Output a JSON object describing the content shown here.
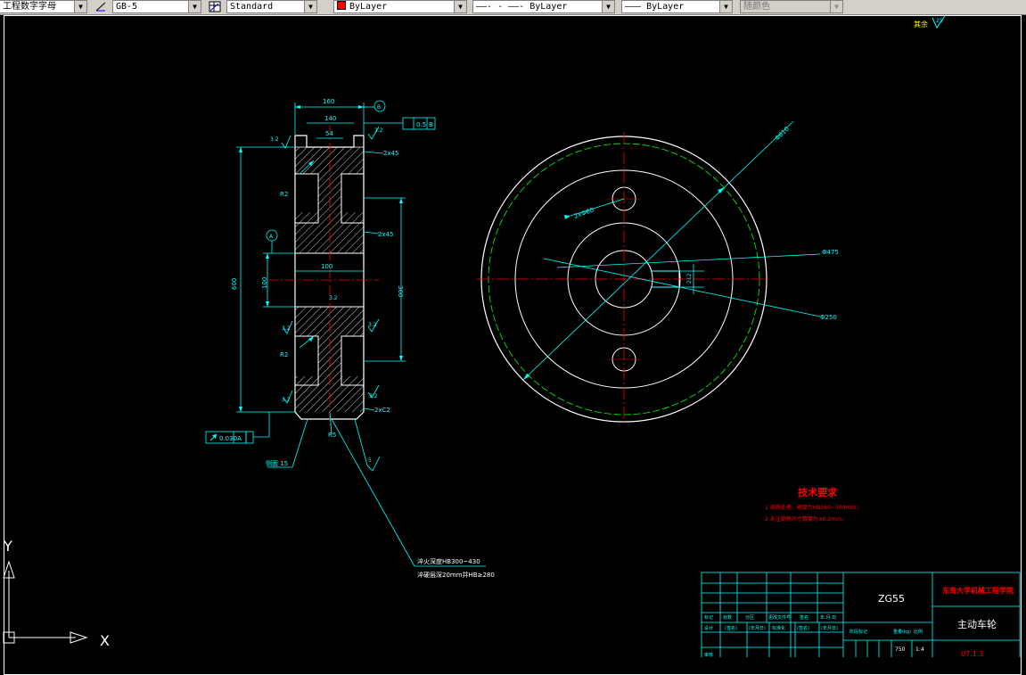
{
  "toolbar": {
    "text_style": "工程数字字母",
    "dim_style": "GB-5",
    "table_style": "Standard",
    "color": "ByLayer",
    "linetype": "ByLayer",
    "lineweight": "ByLayer",
    "plot_style": "随颜色",
    "color_swatch": "#ff0000"
  },
  "drawing": {
    "corner_note": "其余",
    "corner_roughness": "25",
    "left_view": {
      "dim_top_overall": "160",
      "dim_top_inner": "140",
      "dim_groove": "54",
      "datum_b": "B",
      "flatness": "0.5",
      "flatness_datum": "B",
      "roughness_top_left": "3.2",
      "roughness_top_right": "3.2",
      "chamfer_top": "2x45",
      "r_upper": "R2",
      "chamfer_mid": "2x45",
      "datum_a": "A",
      "dim_height": "600",
      "dim_bore": "100",
      "dim_bore_width": "100",
      "dim_hub": "360",
      "roughness_mid": "3.2",
      "roughness_hub": "3.2",
      "roughness_low_left": "3.2",
      "r_lower": "R2",
      "roughness_bot_right": "3.2",
      "roughness_bot_left": "3.2",
      "chamfer_bot": "2xC2",
      "r_bottom": "R5",
      "runout": "0.030",
      "runout_datum": "A",
      "roughness_side": "侧面 15",
      "roughness_bot_sym": "5",
      "note_line1": "淬火深度HB300~430",
      "note_line2": "淬硬层深20mm并HB≥280"
    },
    "right_view": {
      "dim_outer": "Φ610",
      "dim_holes": "2xΦ60",
      "dim_mid": "Φ475",
      "dim_keyway": "212",
      "dim_pcd": "Φ250"
    },
    "tech_req": {
      "title": "技术要求",
      "line1": "1.调质处理，硬度为HB260~300HBS；",
      "line2": "2.未注倒角尺寸精度为±0.2mm。"
    },
    "title_block": {
      "material": "ZG55",
      "company": "东南大学机械工程学院",
      "part_name": "主动车轮",
      "drawing_no": "07.1.3",
      "weight": "750",
      "scale": "1:4",
      "h_mark": "标记",
      "h_qty": "处数",
      "h_zone": "分区",
      "h_doc": "更改文件号",
      "h_sign": "签名",
      "h_date": "年.月.日",
      "h_design": "设计",
      "h_sig2": "(签名)",
      "h_date2": "(年月日)",
      "h_std": "标准化",
      "h_sig3": "(签名)",
      "h_date3": "(年月日)",
      "h_stage": "阶段标记",
      "h_weight": "重量(kg)",
      "h_ratio": "比例",
      "h_review": "审核"
    }
  },
  "ucs": {
    "y": "Y",
    "x": "X"
  }
}
